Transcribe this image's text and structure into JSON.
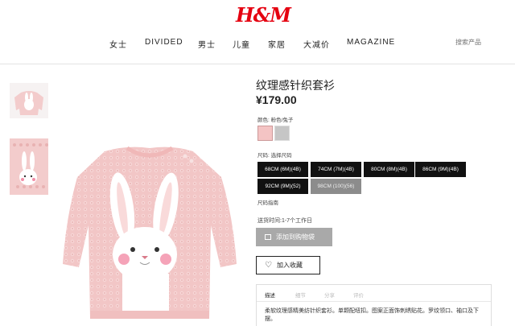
{
  "brand": {
    "logo_text": "H&M",
    "logo_color": "#e50010"
  },
  "nav": {
    "items": [
      "女士",
      "DIVIDED",
      "男士",
      "儿童",
      "家居",
      "大减价",
      "MAGAZINE"
    ]
  },
  "search": {
    "placeholder": "搜索产品"
  },
  "product": {
    "title": "纹理感针织套衫",
    "price": "¥179.00",
    "color_label": "颜色: 粉色/兔子",
    "colors": [
      {
        "name": "pink-swatch",
        "hex": "#f4c4c4"
      },
      {
        "name": "grey-swatch",
        "hex": "#c6c6c6"
      }
    ],
    "size_label": "尺码: 选择尺码",
    "sizes": [
      {
        "label": "68CM (6M)(4B)",
        "available": true
      },
      {
        "label": "74CM (7M)(4B)",
        "available": true
      },
      {
        "label": "80CM (8M)(4B)",
        "available": true
      },
      {
        "label": "86CM (9M)(4B)",
        "available": true
      },
      {
        "label": "92CM (9M)(52)",
        "available": true
      },
      {
        "label": "98CM (100)(56)",
        "available": false
      }
    ],
    "size_guide": "尺码指南",
    "delivery": "送货时间:1-7个工作日",
    "add_to_cart": "添加到购物袋",
    "favorite": "加入收藏",
    "tabs": [
      "描述",
      "细节",
      "分享",
      "评价"
    ],
    "active_tab": "描述",
    "description": "柔软纹理感精美纺针织套衫。单颗配纽扣。图案正面饰刺绣贴花。罗纹领口、袖口及下摆。"
  }
}
